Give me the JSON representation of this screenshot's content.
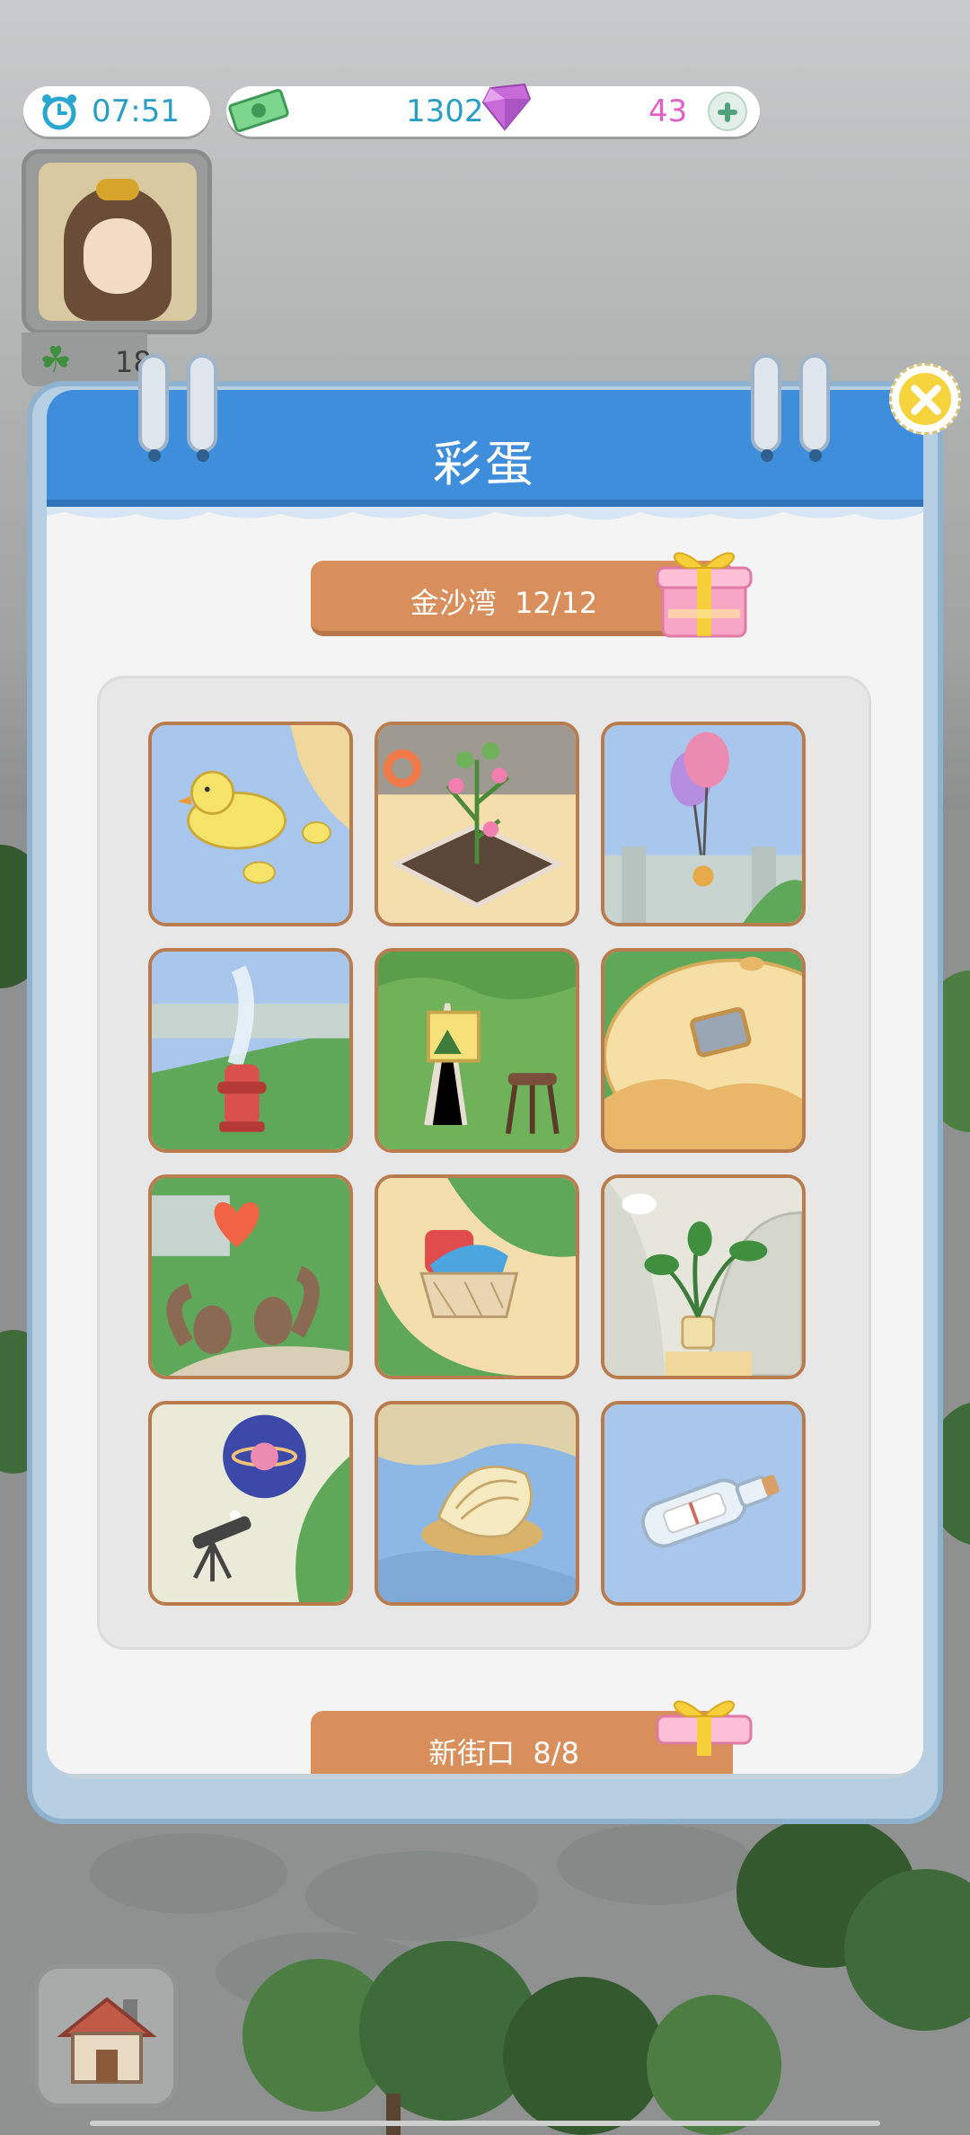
{
  "hud": {
    "clock_icon": "alarm-clock-icon",
    "time": "07:51",
    "cash_icon": "cash-icon",
    "cash": "1302",
    "gem_icon": "diamond-icon",
    "gems": "43",
    "add_icon": "plus-icon",
    "clover_icon": "clover-icon",
    "clover_count": "18"
  },
  "modal": {
    "title": "彩蛋",
    "close_icon": "close-icon",
    "sections": [
      {
        "label": "金沙湾",
        "progress": "12/12",
        "gift_icon": "gift-box-icon",
        "items": [
          "rubber-ducks",
          "heart-flower-planter",
          "balloons-on-railing",
          "fire-hydrant-fountain",
          "painting-easel-and-stool",
          "dome-house-window",
          "squirrels-with-heart",
          "basket-with-clothes",
          "potted-plant-by-rock",
          "telescope-dreaming-planet",
          "seashell",
          "message-in-bottle"
        ]
      },
      {
        "label": "新街口",
        "progress": "8/8",
        "gift_icon": "gift-box-icon"
      }
    ]
  },
  "nav": {
    "home_icon": "home-icon"
  },
  "colors": {
    "header_blue": "#3f8edb",
    "section_orange": "#d98f5c",
    "time_text": "#2a9fc4",
    "gem_text": "#e060c8"
  }
}
